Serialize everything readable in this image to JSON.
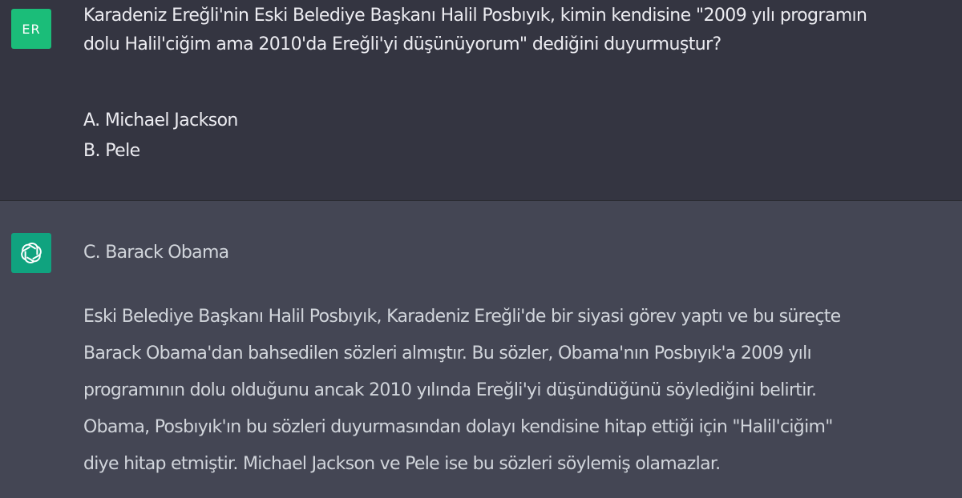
{
  "user_message": {
    "avatar_initials": "ER",
    "question_lines": [
      "Karadeniz Ereğli'nin Eski Belediye Başkanı Halil Posbıyık, kimin kendisine \"2009 yılı programın",
      "dolu Halil'ciğim ama 2010'da Ereğli'yi düşünüyorum\" dediğini duyurmuştur?"
    ],
    "options": [
      "A. Michael Jackson",
      "B. Pele"
    ]
  },
  "assistant_message": {
    "avatar_icon": "openai-logo-icon",
    "answer": "C. Barack Obama",
    "explanation_lines": [
      "Eski Belediye Başkanı Halil Posbıyık, Karadeniz Ereğli'de bir siyasi görev yaptı ve bu süreçte",
      "Barack Obama'dan bahsedilen sözleri almıştır. Bu sözler, Obama'nın Posbıyık'a 2009 yılı",
      "programının dolu olduğunu ancak 2010 yılında Ereğli'yi düşündüğünü söylediğini belirtir.",
      "Obama, Posbıyık'ın bu sözleri duyurmasından dolayı kendisine hitap ettiği için \"Halil'ciğim\"",
      "diye hitap etmiştir. Michael Jackson ve Pele ise bu sözleri söylemiş olamazlar."
    ]
  },
  "colors": {
    "user_bg": "#343541",
    "assistant_bg": "#444654",
    "user_avatar": "#1bbd79",
    "assistant_avatar": "#10a37f",
    "text": "#ececf1"
  }
}
